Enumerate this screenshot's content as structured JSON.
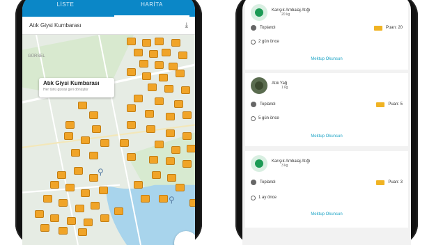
{
  "left_phone": {
    "tabs": [
      {
        "label": "LİSTE"
      },
      {
        "label": "HARİTA"
      }
    ],
    "filter": {
      "label": "Atık Giysi Kumbarası",
      "icon": "download-arrow-icon"
    },
    "map": {
      "area_label": "GÜRSEL",
      "callout": {
        "title": "Atık Giysi Kumbarası",
        "subtitle": "Her türlü giysiyi geri dönüştür"
      }
    }
  },
  "right_phone": {
    "cards": [
      {
        "title": "Karışık Ambalaj Atığı",
        "weight": "20 kg",
        "status": "Toplandı",
        "points": "Puan: 20",
        "time": "2 gün önce",
        "action": "Mektup Okunsun"
      },
      {
        "title": "Atık Yağ",
        "weight": "1 kg",
        "status": "Toplandı",
        "points": "Puan: 5",
        "time": "5 gün önce",
        "action": "Mektup Okunsun"
      },
      {
        "title": "Karışık Ambalaj Atığı",
        "weight": "3 kg",
        "status": "Toplandı",
        "points": "Puan: 3",
        "time": "1 ay önce",
        "action": "Mektup Okunsun"
      }
    ]
  },
  "colors": {
    "primary": "#0b87c7",
    "accent": "#f0b323",
    "link": "#1aa3c5"
  }
}
